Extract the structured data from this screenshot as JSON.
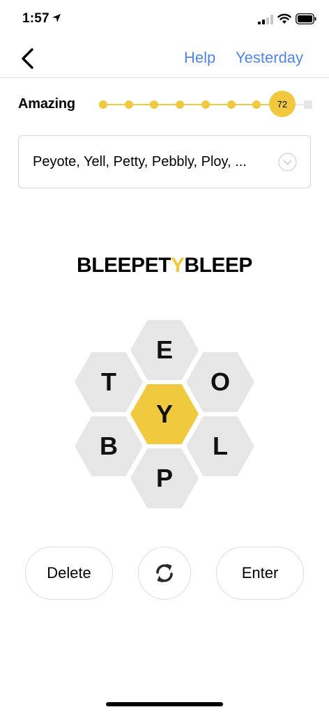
{
  "status_bar": {
    "time": "1:57"
  },
  "nav": {
    "help": "Help",
    "yesterday": "Yesterday"
  },
  "progress": {
    "rank": "Amazing",
    "score": "72",
    "level_index": 7,
    "level_count": 9
  },
  "words_found": {
    "text": "Peyote, Yell, Petty, Pebbly, Ploy, ..."
  },
  "puzzle": {
    "title_prefix": "BLEEPET",
    "center_letter": "Y",
    "title_suffix": "BLEEP"
  },
  "hive": {
    "center": "Y",
    "top": "E",
    "upper_left": "T",
    "upper_right": "O",
    "lower_left": "B",
    "lower_right": "L",
    "bottom": "P"
  },
  "buttons": {
    "delete": "Delete",
    "enter": "Enter"
  },
  "colors": {
    "accent": "#f0c93f",
    "link": "#4f85e5",
    "cell": "#e6e6e6"
  },
  "icons": {
    "shuffle": "shuffle-icon",
    "expand": "chevron-down-circle-icon",
    "back": "chevron-left-icon"
  }
}
